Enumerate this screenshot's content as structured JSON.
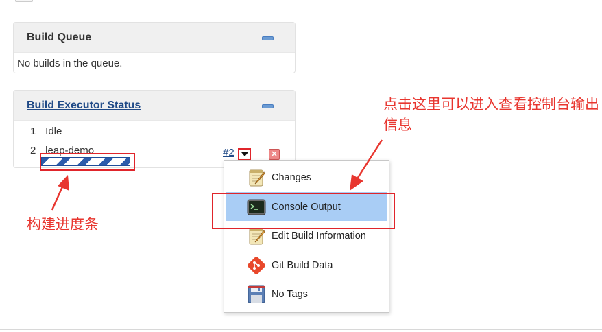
{
  "build_queue": {
    "title": "Build Queue",
    "empty_text": "No builds in the queue."
  },
  "executor_status": {
    "title": "Build Executor Status",
    "executors": [
      {
        "number": "1",
        "status": "Idle"
      },
      {
        "number": "2",
        "status": "leap-demo"
      }
    ],
    "build_link": "#2"
  },
  "context_menu": {
    "items": [
      {
        "label": "Changes",
        "icon": "notepad-icon"
      },
      {
        "label": "Console Output",
        "icon": "terminal-icon"
      },
      {
        "label": "Edit Build Information",
        "icon": "notepad-edit-icon"
      },
      {
        "label": "Git Build Data",
        "icon": "git-icon"
      },
      {
        "label": "No Tags",
        "icon": "floppy-disk-icon"
      }
    ],
    "highlighted": "Console Output"
  },
  "annotations": {
    "console_hint": "点击这里可以进入查看控制台输出信息",
    "progress_hint": "构建进度条"
  },
  "colors": {
    "annotation_red": "#e0252b",
    "link_blue": "#204a87",
    "menu_highlight": "#a9cdf5",
    "progress_blue": "#2b5bab"
  }
}
